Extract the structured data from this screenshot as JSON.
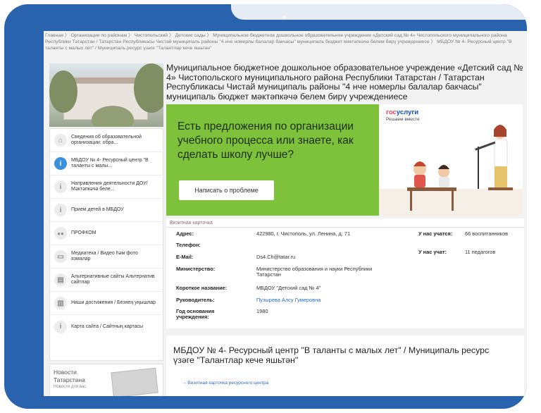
{
  "breadcrumb": "Главная  〉 Организации по районам  〉 Чистопольский  〉 Детские сады  〉 Муниципальное бюджетное дошкольное образовательное учреждение «Детский сад № 4» Чистопольского муниципального района Республики Татарстан / Татарстан Республикасы Чистай муниципаль районы \"4 нче номерлы балалар бакчасы\" муниципаль бюджет мәктәпкәчә белем бирү учреждениесе  〉 МБДОУ № 4- Ресурсный центр \"В таланты с малых лет\" / Муниципаль ресурс үзәге \"Талантлар кече яшьтән\"",
  "page_title": "Муниципальное бюджетное дошкольное образовательное учреждение «Детский сад № 4» Чистопольского муниципального района Республики Татарстан / Татарстан Республикасы Чистай муниципаль районы \"4 нче номерлы балалар бакчасы\" муниципаль бюджет мәктәпкәчә белем бирү учреждениесе",
  "sidebar": {
    "items": [
      {
        "label": "Сведения об образовательной организации: обра...",
        "icon": "building-icon",
        "highlight": false
      },
      {
        "label": "МБДОУ № 4- Ресурсный центр \"В таланты с малы...",
        "icon": "info-icon",
        "highlight": true
      },
      {
        "label": "Направления деятельности ДОУ/ Мәктәпкәчә беле...",
        "icon": "info-icon",
        "highlight": false
      },
      {
        "label": "Прием детей в МБДОУ",
        "icon": "info-icon",
        "highlight": false
      },
      {
        "label": "ПРОФКОМ",
        "icon": "people-icon",
        "highlight": false
      },
      {
        "label": "Медиатека / Видео һәм фото язмалар",
        "icon": "media-icon",
        "highlight": false
      },
      {
        "label": "Альтернативные сайты Альтернатив сайтлар",
        "icon": "sites-icon",
        "highlight": false
      },
      {
        "label": "Наши достижения / Безнең уңышлар",
        "icon": "awards-icon",
        "highlight": false
      },
      {
        "label": "Карта сайта / Сайтның картасы",
        "icon": "info-icon",
        "highlight": false
      }
    ]
  },
  "news": {
    "line1": "Новости",
    "line2": "Татарстана",
    "line3": "Новости для вас"
  },
  "banner": {
    "text": "Есть предложения по организации учебного процесса или знаете, как сделать школу лучше?",
    "button": "Написать о проблеме",
    "logo_part1": "гос",
    "logo_part2": "услуги",
    "tagline": "Решаем вместе",
    "bg_color": "#7ec13a"
  },
  "card": {
    "caption": "Визитная карточка",
    "address_label": "Адрес:",
    "address_value": "422980, г. Чистополь, ул. Ленина, д. 71",
    "phone_label": "Телефон:",
    "email_label": "E-Mail:",
    "email_value": "Ds4.Ch@tatar.ru",
    "ministry_label": "Министерство:",
    "ministry_value": "Министерство образования и науки Республики Татарстан",
    "short_label": "Короткое название:",
    "short_value": "МБДОУ \"Детский сад № 4\"",
    "head_label": "Руководитель:",
    "head_value": "Пузырева Алсу Гумеровна",
    "year_label": "Год основания учреждения:",
    "year_value": "1980",
    "students_label": "У нас учатся:",
    "students_value": "66 воспитанников",
    "teachers_label": "У нас учат:",
    "teachers_value": "11 педагогов"
  },
  "rescenter": {
    "title": "МБДОУ № 4- Ресурсный центр \"В таланты с малых лет\" / Муниципаль ресурс үзәге \"Талантлар кече яшьтән\"",
    "link": "→ Визитная карточка ресурсного центра"
  }
}
